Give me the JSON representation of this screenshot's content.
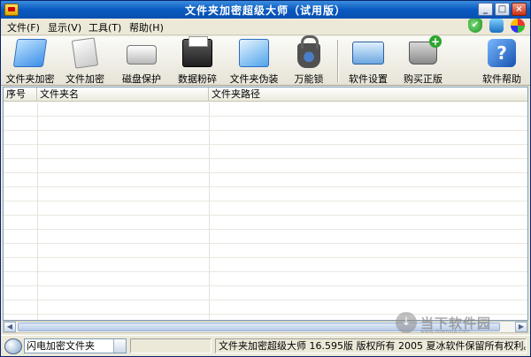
{
  "window": {
    "title": "文件夹加密超级大师（试用版）",
    "minimize": "_",
    "maximize": "□",
    "close": "×"
  },
  "menu": {
    "items": [
      "文件(F)",
      "显示(V)",
      "工具(T)",
      "帮助(H)"
    ]
  },
  "toolbar": {
    "buttons": [
      {
        "label": "文件夹加密",
        "icon": "folder-encrypt-icon"
      },
      {
        "label": "文件加密",
        "icon": "file-encrypt-icon"
      },
      {
        "label": "磁盘保护",
        "icon": "disk-protect-icon"
      },
      {
        "label": "数据粉碎",
        "icon": "shredder-icon"
      },
      {
        "label": "文件夹伪装",
        "icon": "folder-disguise-icon"
      },
      {
        "label": "万能锁",
        "icon": "lock-icon"
      },
      {
        "label": "软件设置",
        "icon": "settings-icon"
      },
      {
        "label": "购买正版",
        "icon": "cart-icon"
      },
      {
        "label": "软件帮助",
        "icon": "help-icon"
      }
    ]
  },
  "list": {
    "columns": [
      "序号",
      "文件夹名",
      "文件夹路径"
    ],
    "rows": []
  },
  "statusbar": {
    "mode_selected": "闪电加密文件夹",
    "copyright": "文件夹加密超级大师 16.595版 版权所有 2005 夏冰软件保留所有权利。"
  },
  "watermark": {
    "text": "当下软件园",
    "sub": "www.downxia.com"
  },
  "colors": {
    "titlebar": "#0a5ac0",
    "window_bg": "#ece9d8",
    "grid_line": "#e8e8e0"
  }
}
